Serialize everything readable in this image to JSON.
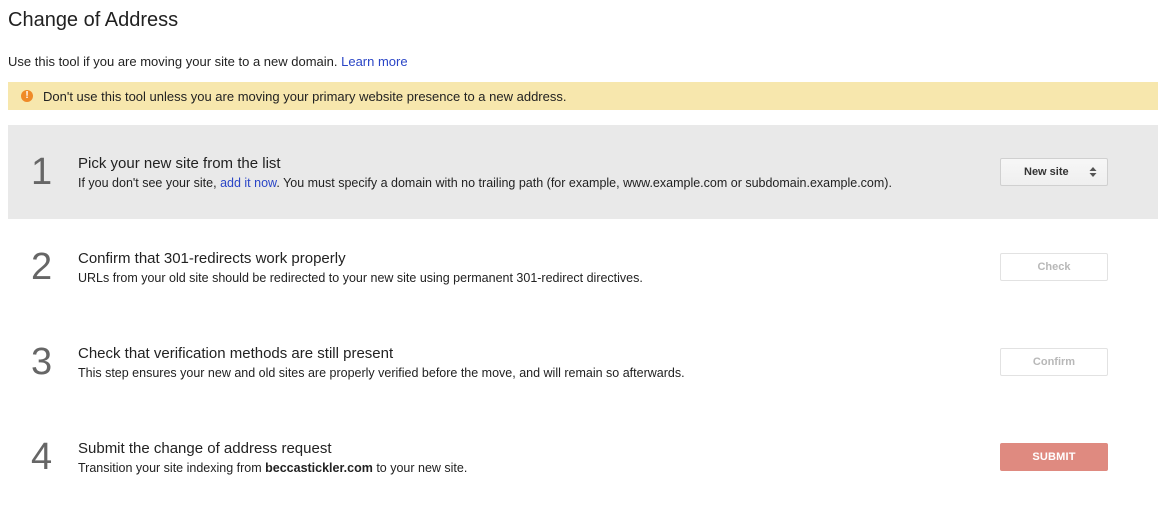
{
  "page": {
    "title": "Change of Address",
    "intro_text": "Use this tool if you are moving your site to a new domain. ",
    "learn_more_label": "Learn more"
  },
  "warning": {
    "icon": "exclamation-circle-icon",
    "text": "Don't use this tool unless you are moving your primary website presence to a new address.",
    "color": "#f7e7ad"
  },
  "steps": [
    {
      "number": "1",
      "title": "Pick your new site from the list",
      "desc_before": "If you don't see your site, ",
      "desc_link": "add it now",
      "desc_after": ". You must specify a domain with no trailing path (for example, www.example.com or subdomain.example.com).",
      "control": {
        "type": "select",
        "label": "New site",
        "icon": "up-down-arrows-icon"
      },
      "active": true
    },
    {
      "number": "2",
      "title": "Confirm that 301-redirects work properly",
      "desc": "URLs from your old site should be redirected to your new site using permanent 301-redirect directives.",
      "control": {
        "type": "button",
        "label": "Check",
        "state": "disabled"
      }
    },
    {
      "number": "3",
      "title": "Check that verification methods are still present",
      "desc": "This step ensures your new and old sites are properly verified before the move, and will remain so afterwards.",
      "control": {
        "type": "button",
        "label": "Confirm",
        "state": "disabled"
      }
    },
    {
      "number": "4",
      "title": "Submit the change of address request",
      "desc_before": "Transition your site indexing from ",
      "desc_bold": "beccastickler.com",
      "desc_after": " to your new site.",
      "control": {
        "type": "button",
        "label": "SUBMIT",
        "state": "disabled",
        "color": "#df8a80"
      }
    }
  ],
  "colors": {
    "active_step_bg": "#e9e9e9",
    "link": "#2a45c6",
    "warning_icon": "#ef8a28"
  }
}
